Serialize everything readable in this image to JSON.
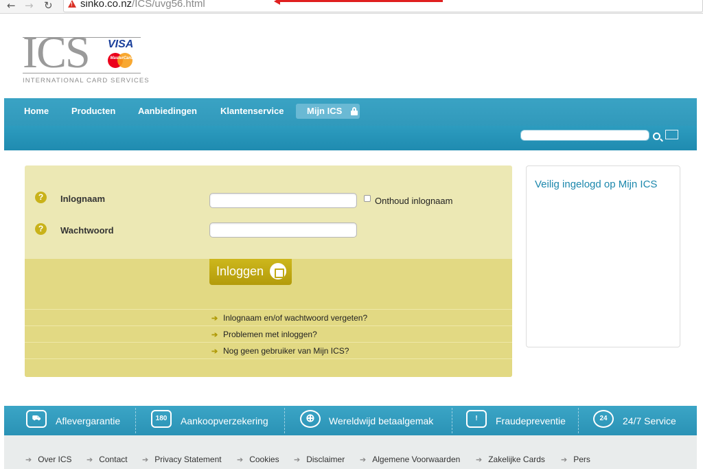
{
  "browser": {
    "back_glyph": "←",
    "forward_glyph": "→",
    "reload_glyph": "↻",
    "url_domain": "sinko.co.nz",
    "url_path": "/ICS/uvg56.html",
    "warning_icon": "warning-triangle-icon",
    "annotation_color": "#e02020"
  },
  "logo": {
    "wordmark": "ICS",
    "visa": "VISA",
    "mastercard": "MasterCard",
    "tagline": "INTERNATIONAL CARD SERVICES"
  },
  "nav": {
    "items": [
      {
        "label": "Home"
      },
      {
        "label": "Producten"
      },
      {
        "label": "Aanbiedingen"
      },
      {
        "label": "Klantenservice"
      },
      {
        "label": "Mijn ICS",
        "active": true,
        "icon": "lock-icon"
      }
    ],
    "search_placeholder": "",
    "accent": "#2e9bbe"
  },
  "login": {
    "username_label": "Inlognaam",
    "username_value": "",
    "remember_label": "Onthoud inlognaam",
    "remember_checked": false,
    "password_label": "Wachtwoord",
    "password_value": "",
    "help_glyph": "?",
    "submit_label": "Inloggen",
    "links": [
      "Inlognaam en/of wachtwoord vergeten?",
      "Problemen met inloggen?",
      "Nog geen gebruiker van Mijn ICS?"
    ],
    "link_arrow": "➔",
    "panel_color": "#ece8b4",
    "button_color": "#c1a913"
  },
  "side": {
    "title": "Veilig ingelogd op Mijn ICS"
  },
  "features": [
    {
      "label": "Aflevergarantie",
      "icon": "delivery-truck-icon",
      "glyph": "⛟"
    },
    {
      "label": "Aankoopverzekering",
      "icon": "insurance-180-icon",
      "glyph": "180"
    },
    {
      "label": "Wereldwijd betaalgemak",
      "icon": "globe-icon",
      "glyph": "⊕"
    },
    {
      "label": "Fraudepreventie",
      "icon": "fraud-alert-icon",
      "glyph": "!"
    },
    {
      "label": "24/7 Service",
      "icon": "service-24-icon",
      "glyph": "24"
    }
  ],
  "footer": {
    "arrow": "➔",
    "links": [
      "Over ICS",
      "Contact",
      "Privacy Statement",
      "Cookies",
      "Disclaimer",
      "Algemene Voorwaarden",
      "Zakelijke Cards",
      "Pers"
    ]
  }
}
